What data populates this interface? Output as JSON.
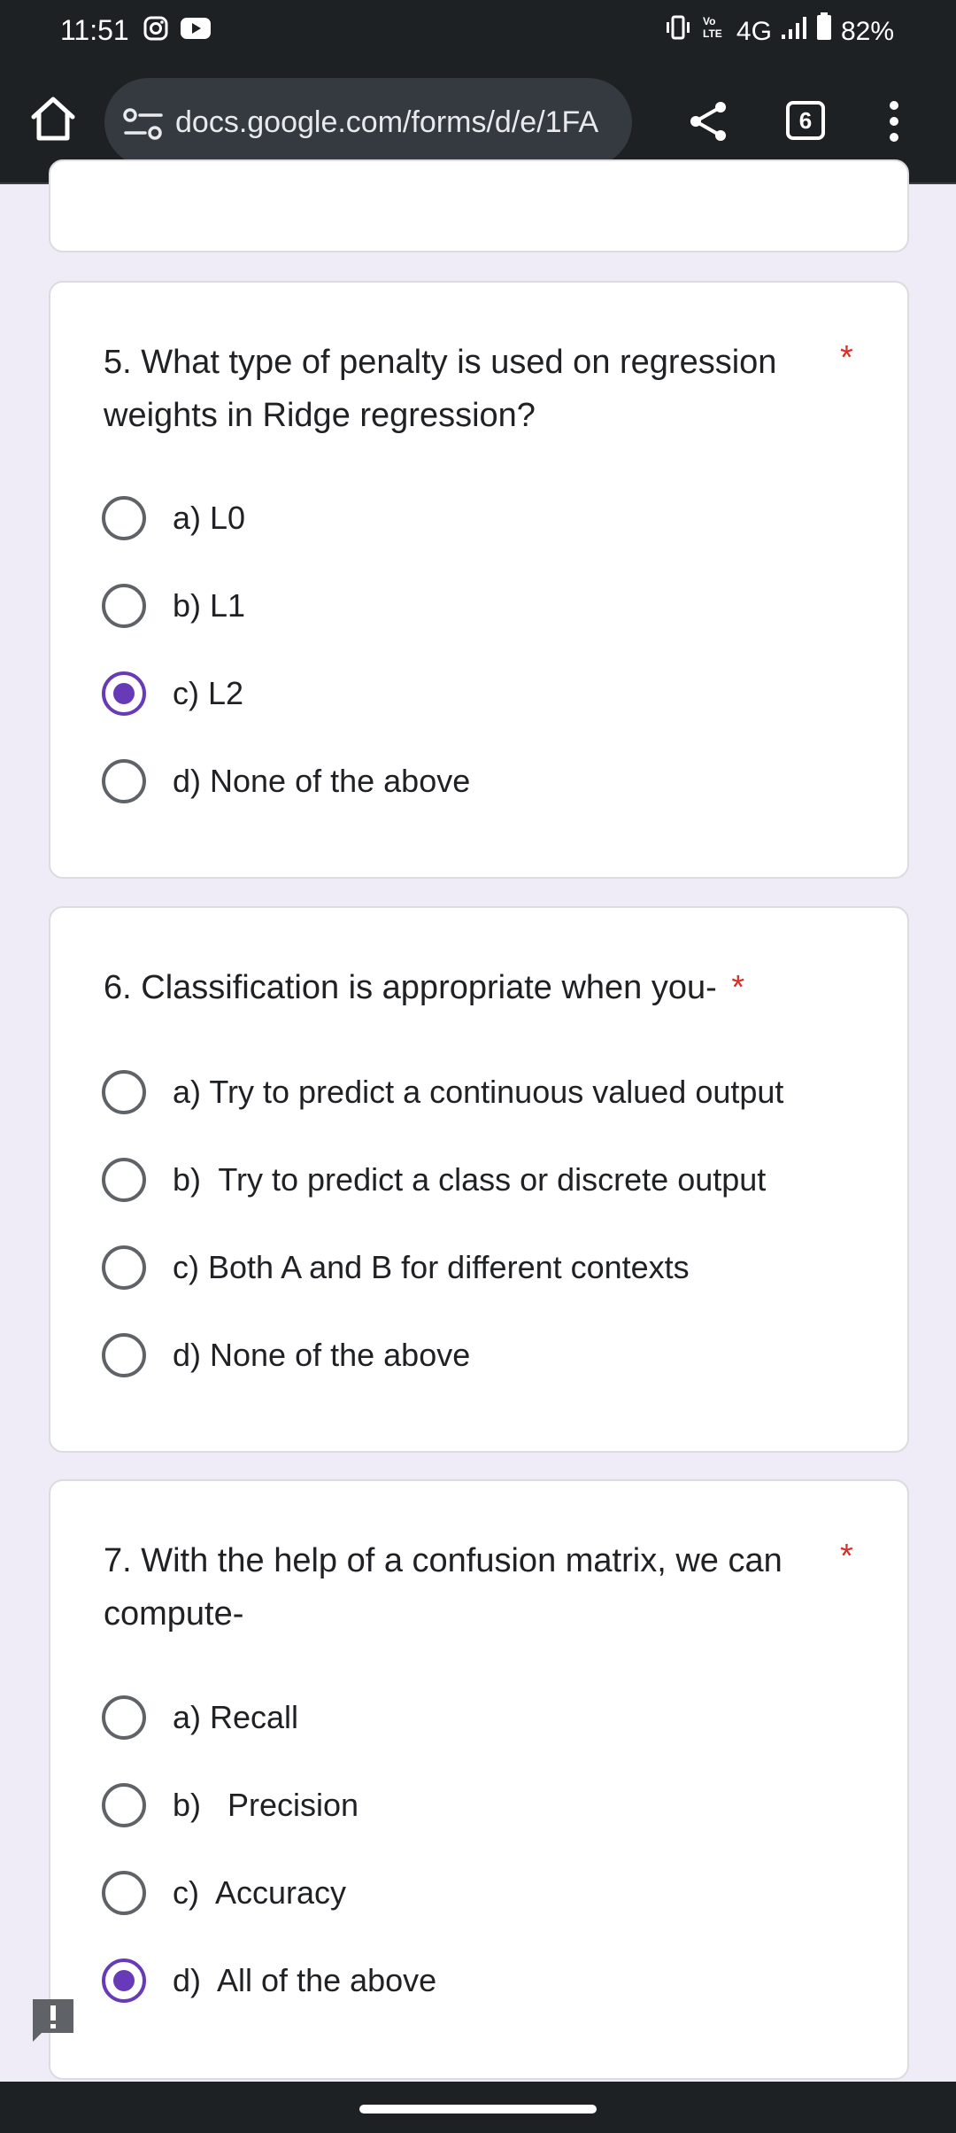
{
  "status_bar": {
    "time": "11:51",
    "network": "4G",
    "battery": "82%",
    "icons": [
      "instagram-icon",
      "youtube-icon",
      "vibrate-icon",
      "volte-icon",
      "signal-icon",
      "battery-icon"
    ]
  },
  "browser": {
    "url": "docs.google.com/forms/d/e/1FA",
    "tab_count": "6",
    "icons": [
      "home-icon",
      "site-settings-icon",
      "share-icon",
      "tabs-icon",
      "more-vert-icon"
    ]
  },
  "questions": [
    {
      "title_line1": "5. What type of penalty is used on regression",
      "title_line2": "weights in Ridge regression?",
      "required_mark": "*",
      "options": [
        {
          "label": "a) L0",
          "checked": false
        },
        {
          "label": "b) L1",
          "checked": false
        },
        {
          "label": "c) L2",
          "checked": true
        },
        {
          "label": "d) None of the above",
          "checked": false
        }
      ]
    },
    {
      "title_line1": "6. Classification is appropriate when you-",
      "required_mark": "*",
      "options": [
        {
          "label": "a) Try to predict a continuous valued output",
          "checked": false
        },
        {
          "label": "b)  Try to predict a class or discrete output",
          "checked": false
        },
        {
          "label": "c) Both A and B for different contexts",
          "checked": false
        },
        {
          "label": "d) None of the above",
          "checked": false
        }
      ]
    },
    {
      "title_line1": "7. With the help of a confusion matrix, we can",
      "title_line2": "compute-",
      "required_mark": "*",
      "options": [
        {
          "label": "a) Recall",
          "checked": false
        },
        {
          "label": "b)   Precision",
          "checked": false
        },
        {
          "label": "c)  Accuracy",
          "checked": false
        },
        {
          "label": "d)  All of the above",
          "checked": true
        }
      ]
    }
  ],
  "colors": {
    "accent": "#673ab7",
    "required": "#d93025",
    "background": "#efebf7",
    "chrome": "#1e2124"
  }
}
